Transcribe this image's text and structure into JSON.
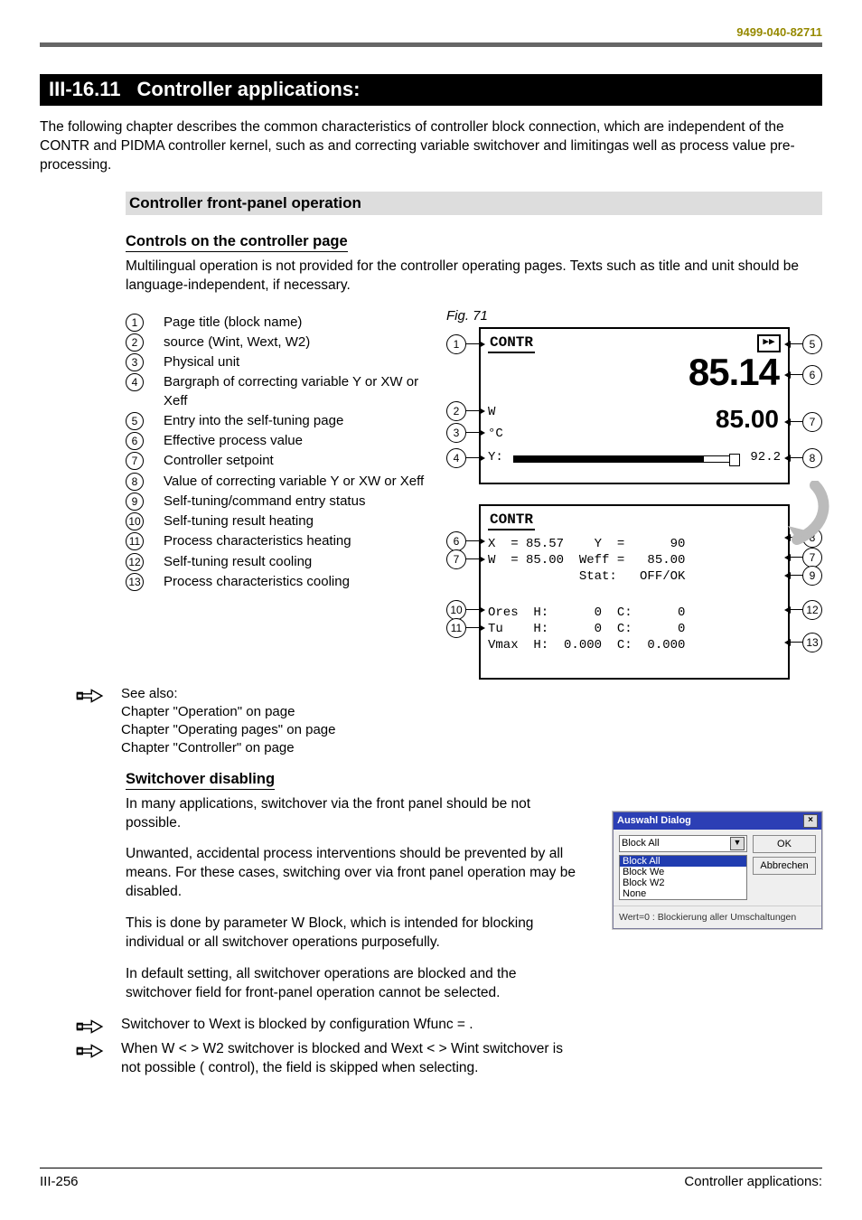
{
  "doc_id": "9499-040-82711",
  "section": {
    "number": "III-16.11",
    "title": "Controller applications:"
  },
  "intro": "The following chapter describes the common characteristics of controller block connection, which are independent of the CONTR and PIDMA controller kernel, such as  and correcting variable switchover and limitingas well as process value pre-processing.",
  "h_front_panel": "Controller front-panel operation",
  "h_controls": "Controls on the controller page",
  "controls_intro": "Multilingual operation is not provided for the controller operating pages. Texts such as title and unit should be language-independent, if necessary.",
  "fig_caption": "Fig. 71",
  "legend": [
    {
      "n": "1",
      "t": "Page title (block name)"
    },
    {
      "n": "2",
      "t": " source (Wint, Wext, W2)"
    },
    {
      "n": "3",
      "t": "Physical unit"
    },
    {
      "n": "4",
      "t": "Bargraph of correcting variable Y or XW or Xeff"
    },
    {
      "n": "5",
      "t": "Entry into the self-tuning page"
    },
    {
      "n": "6",
      "t": "Effective process value"
    },
    {
      "n": "7",
      "t": "Controller setpoint"
    },
    {
      "n": "8",
      "t": "Value of correcting variable Y or XW or Xeff"
    },
    {
      "n": "9",
      "t": "Self-tuning/command entry status"
    },
    {
      "n": "10",
      "t": "Self-tuning result heating"
    },
    {
      "n": "11",
      "t": "Process characteristics heating"
    },
    {
      "n": "12",
      "t": "Self-tuning result cooling"
    },
    {
      "n": "13",
      "t": "Process characteristics cooling"
    }
  ],
  "see_also": {
    "heading": "See also:",
    "lines": [
      "Chapter \"Operation\" on page",
      "Chapter \"Operating pages\" on page",
      "Chapter \"Controller\" on page"
    ]
  },
  "panel_top": {
    "title": "CONTR",
    "self_btn": "▶▶",
    "proc_value": "85.14",
    "w_label": "W",
    "unit_label": "°C",
    "setpoint": "85.00",
    "y_label": "Y:",
    "y_value": "92.2"
  },
  "panel_bot": {
    "title": "CONTR",
    "line1": "X  = 85.57    Y  =      90",
    "line2": "W  = 85.00  Weff =   85.00",
    "line3": "            Stat:   OFF/OK",
    "line4": "Ores  H:      0  C:      0",
    "line5": "Tu    H:      0  C:      0",
    "line6": "Vmax  H:  0.000  C:  0.000"
  },
  "h_switch": "Switchover disabling",
  "switch_p1": "In many applications, switchover via the front panel should be not possible.",
  "switch_p2": "Unwanted, accidental process interventions should be prevented by all means. For these cases, switching over via front panel operation may be disabled.",
  "switch_p3": "This is done by parameter W Block, which is intended for blocking individual or all switchover operations purposefully.",
  "switch_p4": "In default setting, all switchover operations are blocked and the switchover field for front-panel operation cannot be selected.",
  "switch_note1": "Switchover to Wext is blocked by configuration Wfunc = .",
  "switch_note2": "When W < > W2  switchover is blocked and Wext < > Wint switchover is not possible ( control), the field is skipped when selecting.",
  "dialog": {
    "title": "Auswahl Dialog",
    "close": "×",
    "selected": "Block All",
    "options": [
      "Block All",
      "Block We",
      "Block W2",
      "None"
    ],
    "ok": "OK",
    "cancel": "Abbrechen",
    "note": "Wert=0 : Blockierung aller Umschaltungen"
  },
  "footer": {
    "left": "III-256",
    "right": "Controller applications:"
  }
}
